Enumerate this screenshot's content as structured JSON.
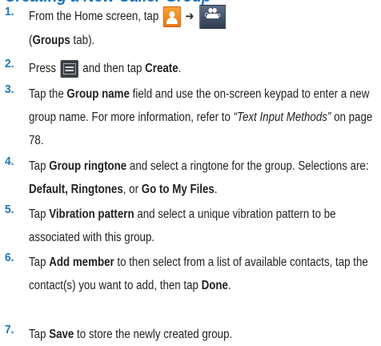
{
  "heading": "Creating a New Caller Group",
  "groups_icon_caption": "Groups",
  "arrow": "➔",
  "steps": [
    {
      "num": "1.",
      "a": "From the Home screen, tap ",
      "b": "(",
      "c": "Groups",
      "d": " tab)."
    },
    {
      "num": "2.",
      "a": "Press ",
      "b": " and then tap ",
      "c": "Create",
      "d": "."
    },
    {
      "num": "3.",
      "a": "Tap the ",
      "b": "Group name",
      "c": " field and use the on-screen keypad to enter a new group name. For more information, refer to ",
      "d": "“Text Input Methods”",
      "e": " on page 78."
    },
    {
      "num": "4.",
      "a": "Tap ",
      "b": "Group ringtone",
      "c": " and select a ringtone for the group. Selections are: ",
      "d": "Default, Ringtones",
      "e": ", or ",
      "f": "Go to My Files",
      "g": "."
    },
    {
      "num": "5.",
      "a": "Tap ",
      "b": "Vibration pattern",
      "c": " and select a unique vibration pattern to be associated with this group."
    },
    {
      "num": "6.",
      "a": "Tap ",
      "b": "Add member",
      "c": " to then select from a list of available contacts, tap the contact(s) you want to add, then tap ",
      "d": "Done",
      "e": "."
    },
    {
      "num": "7.",
      "a": "Tap ",
      "b": "Save",
      "c": " to store the newly created group."
    }
  ]
}
